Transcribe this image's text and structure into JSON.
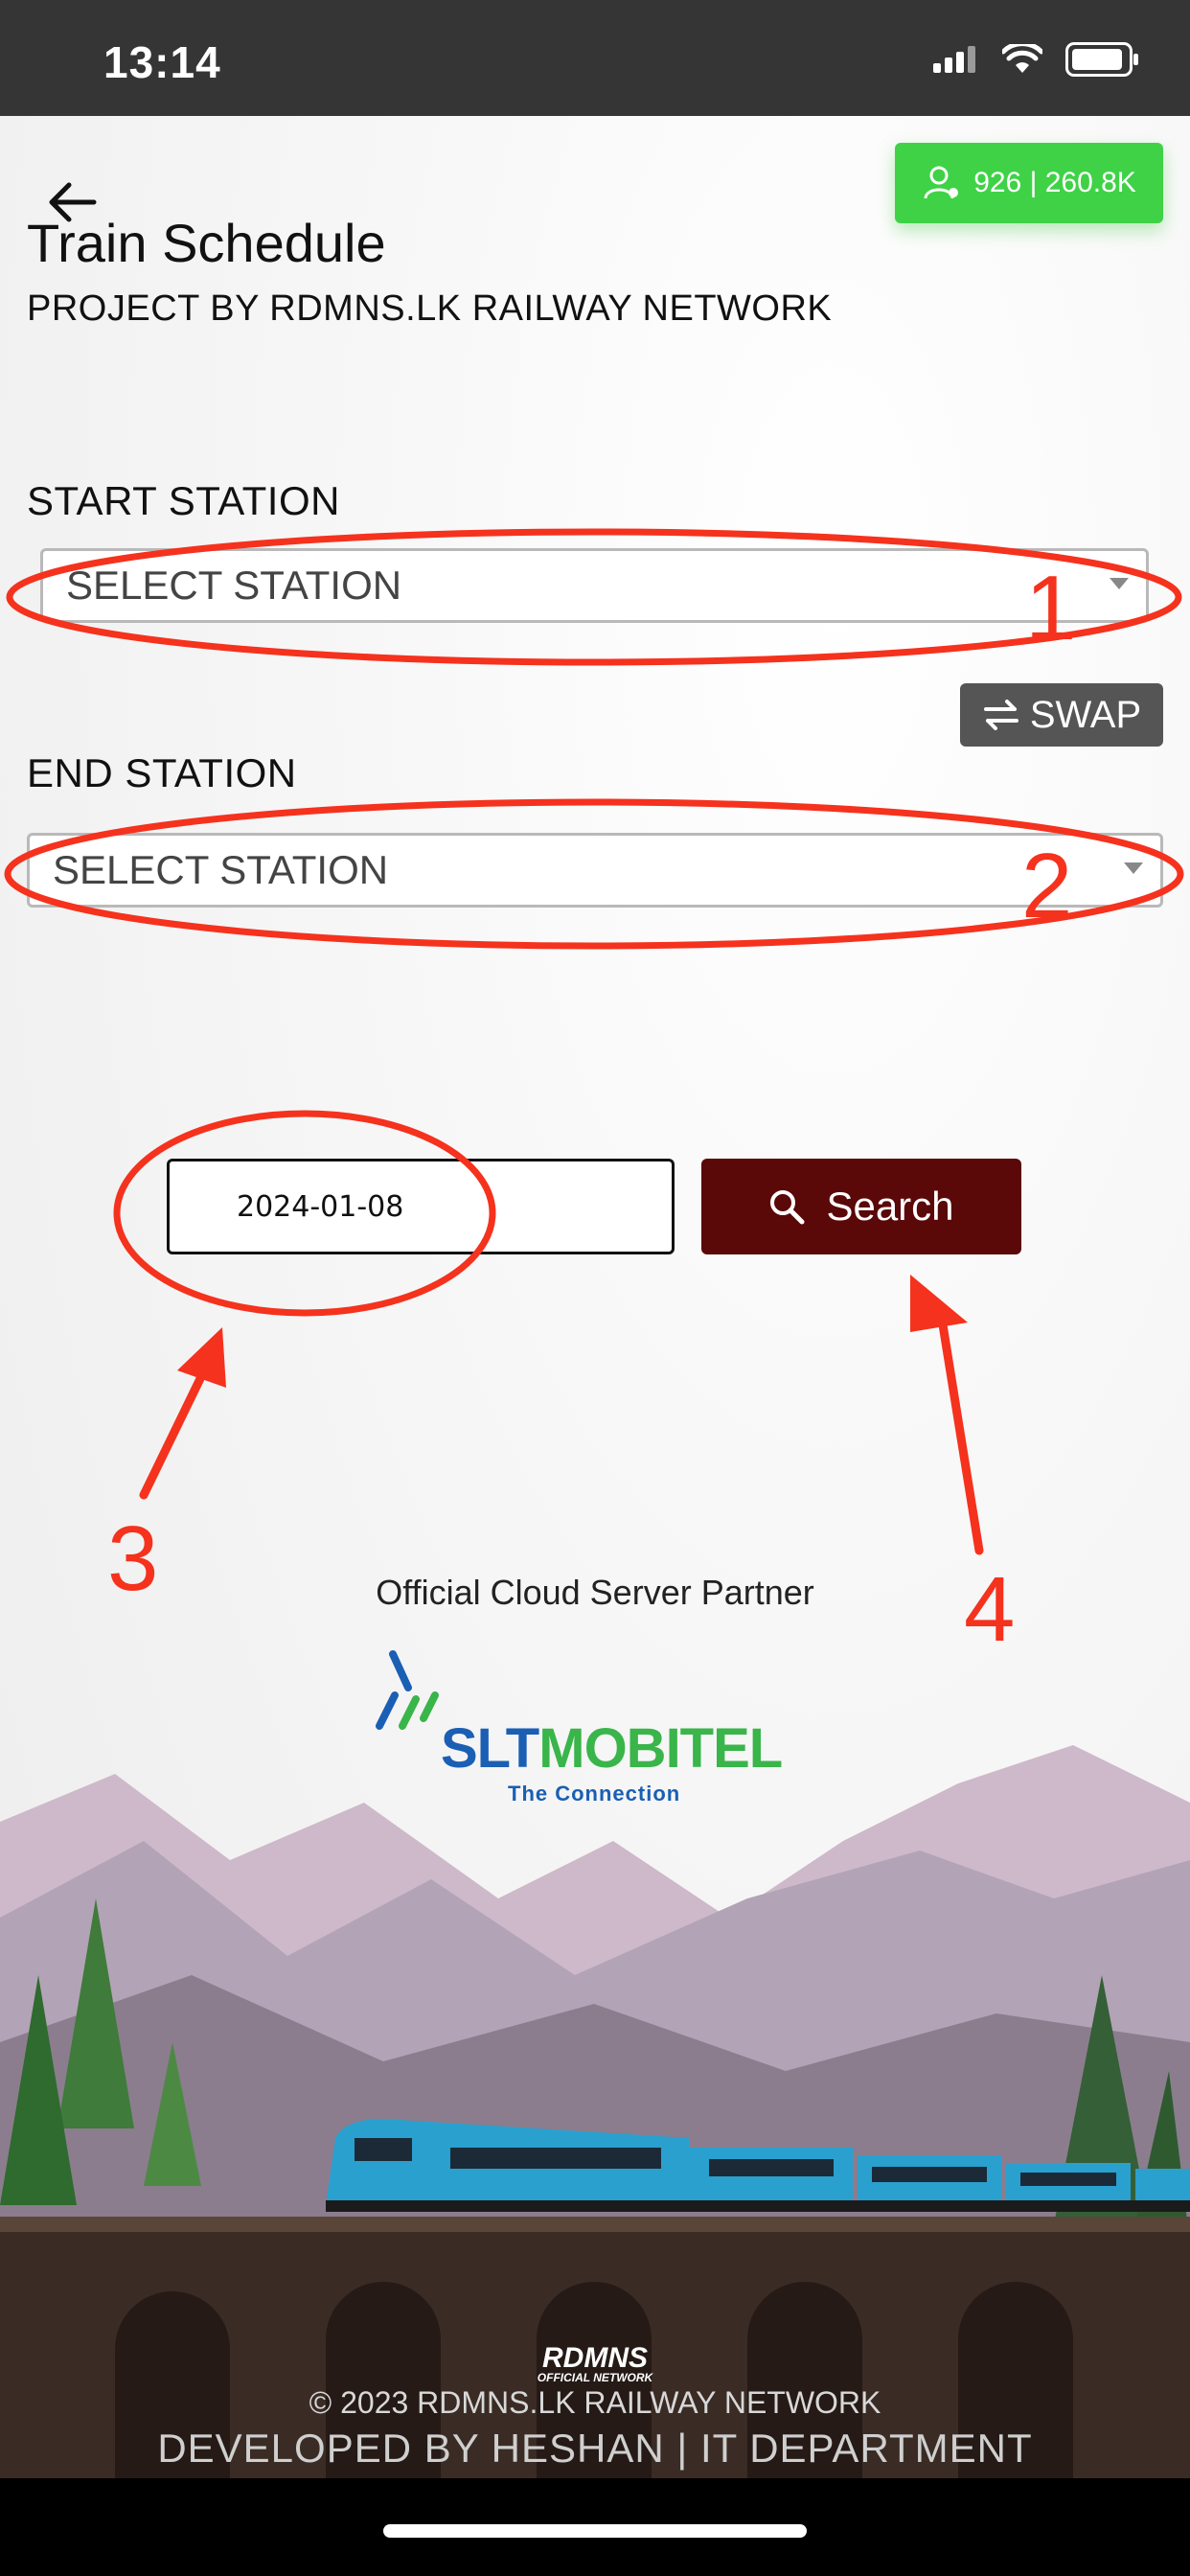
{
  "status_bar": {
    "time": "13:14"
  },
  "header": {
    "back_icon": "arrow-left-icon",
    "title": "Train Schedule",
    "subtitle": "PROJECT BY RDMNS.LK RAILWAY NETWORK",
    "counter": "926 | 260.8K"
  },
  "form": {
    "start_label": "START STATION",
    "start_placeholder": "SELECT STATION",
    "swap_label": "SWAP",
    "end_label": "END STATION",
    "end_placeholder": "SELECT STATION",
    "date_value": "2024-01-08",
    "search_label": "Search"
  },
  "partner": {
    "caption": "Official Cloud Server Partner",
    "logo_prefix": "SLT",
    "logo_suffix": "MOBITEL",
    "tagline": "The Connection"
  },
  "footer": {
    "logo_text": "RDMNS",
    "logo_sub": "OFFICIAL NETWORK",
    "copyright": "© 2023 RDMNS.LK RAILWAY NETWORK",
    "developer": "DEVELOPED BY HESHAN | IT DEPARTMENT"
  },
  "annotations": [
    "1",
    "2",
    "3",
    "4"
  ],
  "colors": {
    "accent_green": "#3fd247",
    "search_bg": "#5a0808",
    "annotation_red": "#f5321d"
  }
}
